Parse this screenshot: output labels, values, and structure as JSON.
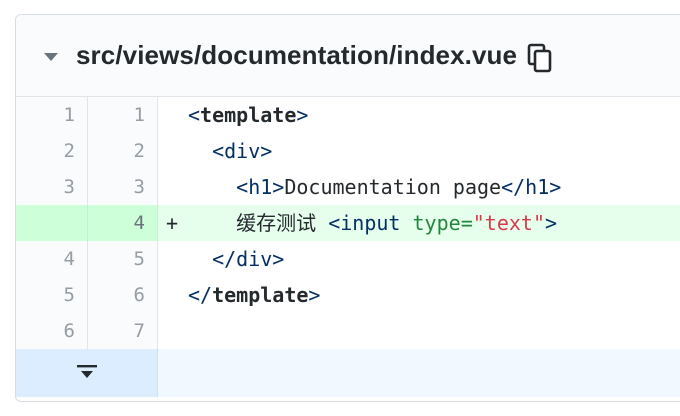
{
  "file": {
    "path": "src/views/documentation/index.vue",
    "collapse_icon": "chevron-down-icon",
    "copy_icon": "copy-icon"
  },
  "lines": [
    {
      "old": "1",
      "new": "1",
      "marker": "",
      "type": "context"
    },
    {
      "old": "2",
      "new": "2",
      "marker": "",
      "type": "context"
    },
    {
      "old": "3",
      "new": "3",
      "marker": "",
      "type": "context"
    },
    {
      "old": "",
      "new": "4",
      "marker": "+",
      "type": "added"
    },
    {
      "old": "4",
      "new": "5",
      "marker": "",
      "type": "context"
    },
    {
      "old": "5",
      "new": "6",
      "marker": "",
      "type": "context"
    },
    {
      "old": "6",
      "new": "7",
      "marker": "",
      "type": "context"
    }
  ],
  "code": {
    "l1": {
      "open": "<",
      "name": "template",
      "close": ">"
    },
    "l2": {
      "text": "<div>"
    },
    "l3": {
      "open": "<h1>",
      "text": "Documentation page",
      "close": "</h1>"
    },
    "l4": {
      "cjk": "缓存测试",
      "open": "<input",
      "attr": "type",
      "eq": "=",
      "value": "\"text\"",
      "close": ">"
    },
    "l5": {
      "text": "</div>"
    },
    "l6": {
      "open": "</",
      "name": "template",
      "close": ">"
    },
    "l7": {
      "text": ""
    }
  },
  "expand": {
    "icon": "expand-down-icon"
  },
  "colors": {
    "added_line": "#e6ffed",
    "added_gutter": "#cdffd8",
    "expand_bg": "#f1f8ff"
  }
}
